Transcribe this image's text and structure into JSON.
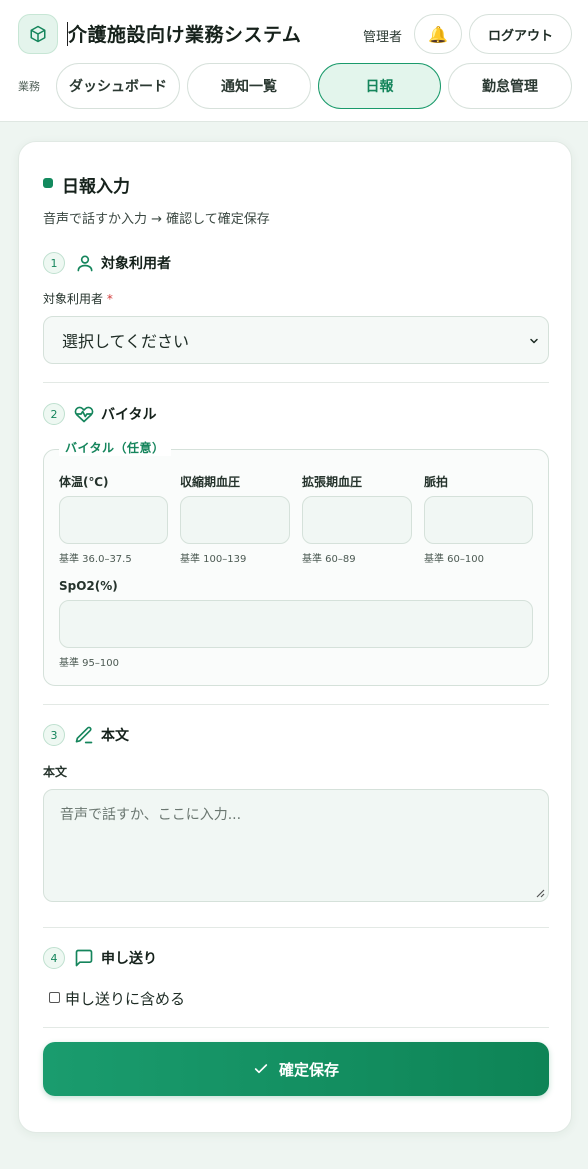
{
  "header": {
    "app_title": "介護施設向け業務システム",
    "role": "管理者",
    "bell_glyph": "🔔",
    "logout_label": "ログアウト",
    "nav_label": "業務",
    "tabs": [
      {
        "label": "ダッシュボード",
        "active": false
      },
      {
        "label": "通知一覧",
        "active": false
      },
      {
        "label": "日報",
        "active": true
      },
      {
        "label": "勤怠管理",
        "active": false
      }
    ]
  },
  "form": {
    "title": "日報入力",
    "subtitle": "音声で話すか入力 → 確認して確定保存",
    "steps": {
      "subject": {
        "num": "1",
        "title": "対象利用者",
        "icon": "user-icon"
      },
      "vitals": {
        "num": "2",
        "title": "バイタル",
        "icon": "heart-pulse-icon"
      },
      "body": {
        "num": "3",
        "title": "本文",
        "icon": "pencil-icon"
      },
      "handover": {
        "num": "4",
        "title": "申し送り",
        "icon": "message-square-icon"
      }
    },
    "subject_field": {
      "label": "対象利用者",
      "required_mark": "*",
      "selected": "選択してください"
    },
    "vitals": {
      "legend": "バイタル（任意）",
      "temp": {
        "label": "体温(℃)",
        "hint": "基準 36.0–37.5",
        "value": ""
      },
      "systolic": {
        "label": "収縮期血圧",
        "hint": "基準 100–139",
        "value": ""
      },
      "diastolic": {
        "label": "拡張期血圧",
        "hint": "基準 60–89",
        "value": ""
      },
      "pulse": {
        "label": "脈拍",
        "hint": "基準 60–100",
        "value": ""
      },
      "spo2": {
        "label": "SpO2(%)",
        "hint": "基準 95–100",
        "value": ""
      }
    },
    "body_field": {
      "label": "本文",
      "placeholder": "音声で話すか、ここに入力..."
    },
    "handover": {
      "checkbox_label": "申し送りに含める",
      "checked": false
    },
    "save_label": "確定保存"
  },
  "colors": {
    "accent": "#15855c",
    "accent_bg": "#e3f5ec",
    "button_gradient_start": "#1a9c6e",
    "button_gradient_end": "#0e8456"
  }
}
